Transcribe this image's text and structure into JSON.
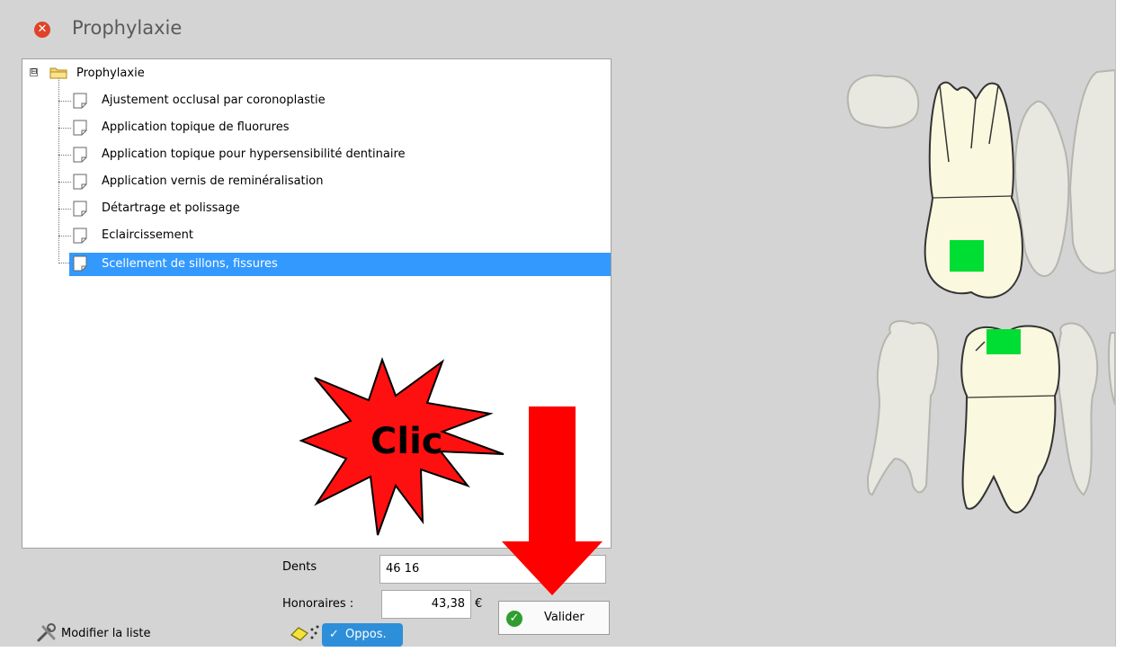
{
  "window": {
    "title": "Prophylaxie"
  },
  "tree": {
    "root_label": "Prophylaxie",
    "expander": "⊟",
    "items": [
      "Ajustement occlusal par coronoplastie",
      "Application topique de fluorures",
      "Application topique pour hypersensibilité dentinaire",
      "Application vernis de reminéralisation",
      "Détartrage et polissage",
      "Eclaircissement",
      "Scellement de sillons, fissures"
    ],
    "selected_index": 6
  },
  "form": {
    "dents_label": "Dents",
    "dents_value": "46 16",
    "honoraires_label": "Honoraires :",
    "honoraires_value": "43,38",
    "currency": "€",
    "valider_label": "Valider",
    "oppos_label": "Oppos.",
    "modifier_label": "Modifier la liste"
  },
  "annotation": {
    "burst_text": "Clic"
  },
  "colors": {
    "selection": "#3399ff",
    "accent_blue": "#2d8fd9",
    "annotation_red": "#ff0000",
    "marker_green": "#00dd33",
    "tooth_fill": "#fbf8e0",
    "tooth_ghost": "#e8e8e0"
  },
  "icons": [
    "close-icon",
    "folder-icon",
    "document-icon",
    "tools-icon",
    "eraser-icon",
    "dots-icon",
    "checkmark-icon"
  ]
}
